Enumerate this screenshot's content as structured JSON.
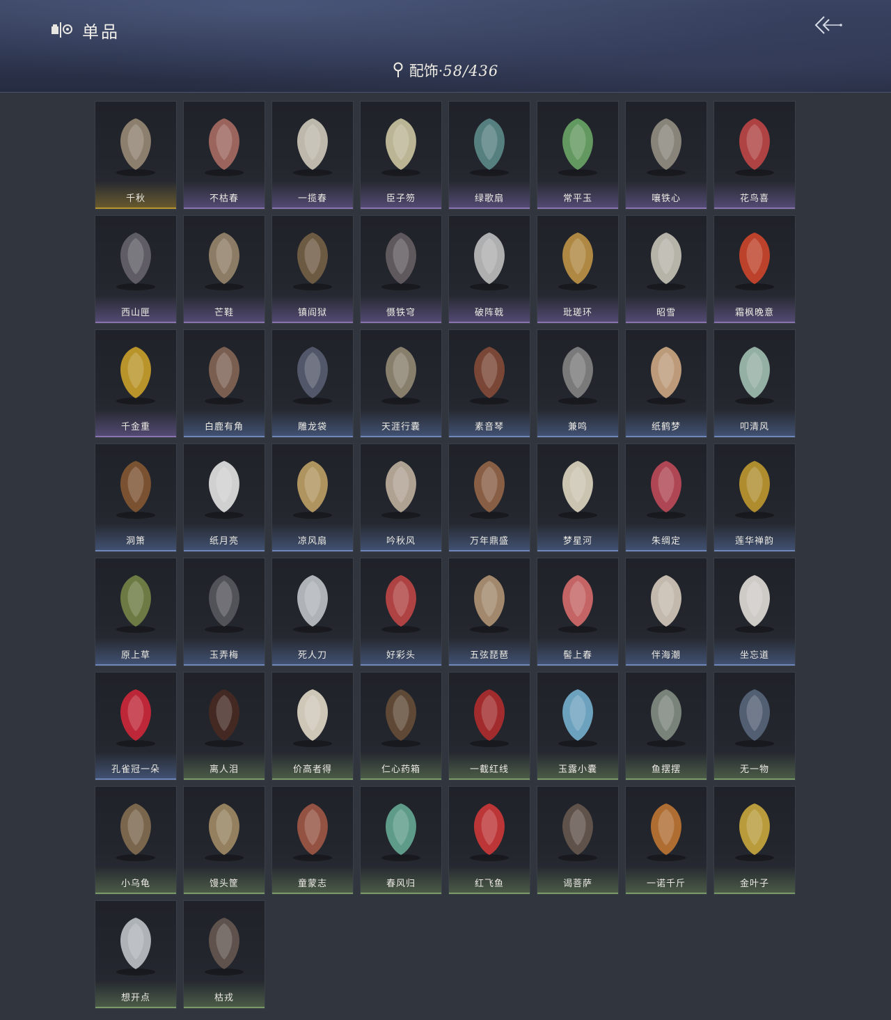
{
  "header": {
    "title": "单品",
    "category_label": "配饰·",
    "category_count": "58/436",
    "logo_icon": "collection-icon",
    "back_icon": "back-arrow-icon"
  },
  "rarity_colors": {
    "gold": "#b8962e",
    "purple": "#8a74b0",
    "blue": "#6f86b8",
    "green": "#7a9a68"
  },
  "items": [
    {
      "name": "千秋",
      "rarity": "gold",
      "icon": "pipa-instrument-icon",
      "color": "#a08f7a"
    },
    {
      "name": "不枯春",
      "rarity": "purple",
      "icon": "branch-hairpin-icon",
      "color": "#b07066"
    },
    {
      "name": "一揽春",
      "rarity": "purple",
      "icon": "flower-basket-icon",
      "color": "#d8d2c2"
    },
    {
      "name": "臣子笏",
      "rarity": "purple",
      "icon": "tablet-icon",
      "color": "#d6cfa8"
    },
    {
      "name": "绿歌扇",
      "rarity": "purple",
      "icon": "round-fan-icon",
      "color": "#5f8f8f"
    },
    {
      "name": "常平玉",
      "rarity": "purple",
      "icon": "jade-pendant-icon",
      "color": "#6fae6a"
    },
    {
      "name": "嚷铁心",
      "rarity": "purple",
      "icon": "curved-blade-icon",
      "color": "#9a9588"
    },
    {
      "name": "花鸟喜",
      "rarity": "purple",
      "icon": "bird-kite-icon",
      "color": "#c84848"
    },
    {
      "name": "西山匣",
      "rarity": "purple",
      "icon": "crossbow-case-icon",
      "color": "#6a6670"
    },
    {
      "name": "芒鞋",
      "rarity": "purple",
      "icon": "straw-sandals-icon",
      "color": "#a08c70"
    },
    {
      "name": "镇阎狱",
      "rarity": "purple",
      "icon": "staff-icon",
      "color": "#7a6448"
    },
    {
      "name": "慑铁穹",
      "rarity": "purple",
      "icon": "banner-spear-icon",
      "color": "#6a6266"
    },
    {
      "name": "破阵戟",
      "rarity": "purple",
      "icon": "halberd-icon",
      "color": "#c8c8c8"
    },
    {
      "name": "玭瑳环",
      "rarity": "purple",
      "icon": "tassel-charm-icon",
      "color": "#c89a48"
    },
    {
      "name": "昭雪",
      "rarity": "purple",
      "icon": "hanging-chimes-icon",
      "color": "#d0ccc0"
    },
    {
      "name": "霜枫晚意",
      "rarity": "purple",
      "icon": "maple-leaves-icon",
      "color": "#d8482c"
    },
    {
      "name": "千金重",
      "rarity": "purple",
      "icon": "golden-bird-icon",
      "color": "#d4a82a"
    },
    {
      "name": "白鹿有角",
      "rarity": "blue",
      "icon": "antler-icon",
      "color": "#8a6a58"
    },
    {
      "name": "雕龙袋",
      "rarity": "blue",
      "icon": "cage-pack-icon",
      "color": "#5a6074"
    },
    {
      "name": "天涯行囊",
      "rarity": "blue",
      "icon": "travel-bag-icon",
      "color": "#9a8e78"
    },
    {
      "name": "素音琴",
      "rarity": "blue",
      "icon": "zither-icon",
      "color": "#8a4e3a"
    },
    {
      "name": "兼鸣",
      "rarity": "blue",
      "icon": "shield-emblem-icon",
      "color": "#8a8a8a"
    },
    {
      "name": "纸鹤梦",
      "rarity": "blue",
      "icon": "paper-crane-icon",
      "color": "#d8b088"
    },
    {
      "name": "叩清风",
      "rarity": "blue",
      "icon": "round-fan-icon",
      "color": "#a8c8b8"
    },
    {
      "name": "洞箫",
      "rarity": "blue",
      "icon": "flute-icon",
      "color": "#8a5a34"
    },
    {
      "name": "纸月亮",
      "rarity": "blue",
      "icon": "paper-lantern-icon",
      "color": "#eeeeee"
    },
    {
      "name": "凉风扇",
      "rarity": "blue",
      "icon": "round-fan-icon",
      "color": "#c8a868"
    },
    {
      "name": "吟秋风",
      "rarity": "blue",
      "icon": "leaf-fan-icon",
      "color": "#c8b8a4"
    },
    {
      "name": "万年鼎盛",
      "rarity": "blue",
      "icon": "cauldron-icon",
      "color": "#9a6a4a"
    },
    {
      "name": "梦星河",
      "rarity": "blue",
      "icon": "flower-cradle-icon",
      "color": "#e8e0c8"
    },
    {
      "name": "朱绸定",
      "rarity": "blue",
      "icon": "red-bow-icon",
      "color": "#c84c5c"
    },
    {
      "name": "莲华禅韵",
      "rarity": "blue",
      "icon": "golden-lotus-icon",
      "color": "#c8a030"
    },
    {
      "name": "原上草",
      "rarity": "blue",
      "icon": "grass-basket-icon",
      "color": "#7a8a48"
    },
    {
      "name": "玉弄梅",
      "rarity": "blue",
      "icon": "quiver-icon",
      "color": "#5a5a62"
    },
    {
      "name": "死人刀",
      "rarity": "blue",
      "icon": "saber-icon",
      "color": "#c8ccd0"
    },
    {
      "name": "好彩头",
      "rarity": "blue",
      "icon": "lion-drum-icon",
      "color": "#c84848"
    },
    {
      "name": "五弦琵琶",
      "rarity": "blue",
      "icon": "lute-icon",
      "color": "#b89a78"
    },
    {
      "name": "髻上春",
      "rarity": "blue",
      "icon": "peony-icon",
      "color": "#e07070"
    },
    {
      "name": "伴海潮",
      "rarity": "blue",
      "icon": "starfish-icon",
      "color": "#e0d4c4"
    },
    {
      "name": "坐忘道",
      "rarity": "blue",
      "icon": "mask-icon",
      "color": "#ece8e2"
    },
    {
      "name": "孔雀冠一朵",
      "rarity": "blue",
      "icon": "red-flower-icon",
      "color": "#d8283a"
    },
    {
      "name": "离人泪",
      "rarity": "green",
      "icon": "wine-jar-icon",
      "color": "#4a2a22"
    },
    {
      "name": "价高者得",
      "rarity": "green",
      "icon": "shop-banner-icon",
      "color": "#ece4d0"
    },
    {
      "name": "仁心药箱",
      "rarity": "green",
      "icon": "medicine-box-icon",
      "color": "#6a5038"
    },
    {
      "name": "一截红线",
      "rarity": "green",
      "icon": "red-cord-icon",
      "color": "#b82e2e"
    },
    {
      "name": "玉露小囊",
      "rarity": "green",
      "icon": "sachet-icon",
      "color": "#7ab8d8"
    },
    {
      "name": "鱼摆摆",
      "rarity": "green",
      "icon": "fish-icon",
      "color": "#8a9488"
    },
    {
      "name": "无一物",
      "rarity": "green",
      "icon": "cloth-pouch-icon",
      "color": "#5a6a80"
    },
    {
      "name": "小乌龟",
      "rarity": "green",
      "icon": "turtle-icon",
      "color": "#8a7254"
    },
    {
      "name": "馒头筐",
      "rarity": "green",
      "icon": "bun-basket-icon",
      "color": "#a89068"
    },
    {
      "name": "童蒙志",
      "rarity": "green",
      "icon": "crossed-swords-icon",
      "color": "#a85a48"
    },
    {
      "name": "春风归",
      "rarity": "green",
      "icon": "swallow-kite-icon",
      "color": "#6ab09a"
    },
    {
      "name": "红飞鱼",
      "rarity": "green",
      "icon": "fish-kite-icon",
      "color": "#d83a3a"
    },
    {
      "name": "谒菩萨",
      "rarity": "green",
      "icon": "daggers-icon",
      "color": "#6a5a50"
    },
    {
      "name": "一诺千斤",
      "rarity": "green",
      "icon": "roast-chicken-icon",
      "color": "#c87a34"
    },
    {
      "name": "金叶子",
      "rarity": "green",
      "icon": "gold-leaf-icon",
      "color": "#d4b040"
    },
    {
      "name": "想开点",
      "rarity": "green",
      "icon": "cleaver-icon",
      "color": "#c8ccd0"
    },
    {
      "name": "枯戎",
      "rarity": "green",
      "icon": "dry-branch-icon",
      "color": "#6a5a52"
    }
  ]
}
